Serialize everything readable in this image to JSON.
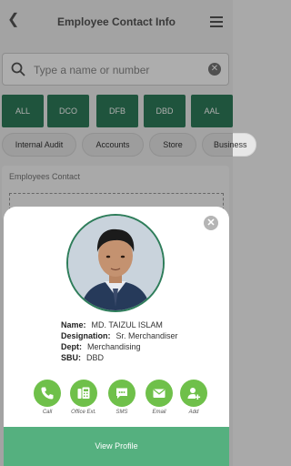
{
  "header": {
    "title": "Employee Contact Info"
  },
  "search": {
    "placeholder": "Type a name or number"
  },
  "sbu_tabs": [
    "ALL",
    "DCO",
    "DFB",
    "DBD",
    "AAL"
  ],
  "dept_tabs": [
    "Internal Audit",
    "Accounts",
    "Store",
    "Business"
  ],
  "contacts": {
    "title": "Employees Contact"
  },
  "profile": {
    "name_label": "Name:",
    "name": "MD. TAIZUL ISLAM",
    "designation_label": "Designation:",
    "designation": "Sr. Merchandiser",
    "dept_label": "Dept:",
    "dept": "Merchandising",
    "sbu_label": "SBU:",
    "sbu": "DBD"
  },
  "actions": [
    {
      "label": "Call",
      "icon": "phone-icon"
    },
    {
      "label": "Office Ext.",
      "icon": "office-ext-icon"
    },
    {
      "label": "SMS",
      "icon": "sms-icon"
    },
    {
      "label": "Email",
      "icon": "email-icon"
    },
    {
      "label": "Add",
      "icon": "add-contact-icon"
    }
  ],
  "view_profile_label": "View Profile",
  "colors": {
    "primary": "#2e7d5a",
    "action": "#6fc04a",
    "button": "#55b07f"
  }
}
